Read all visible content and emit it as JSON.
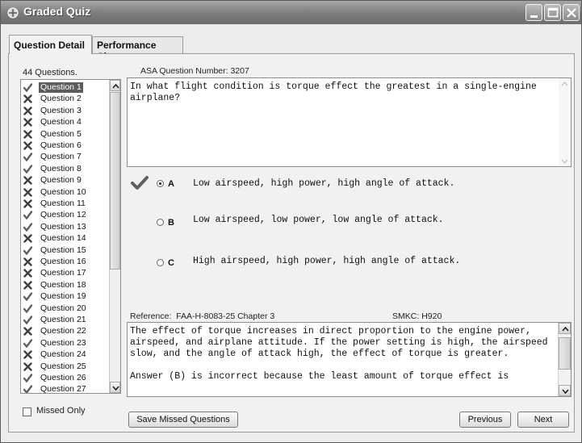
{
  "window": {
    "title": "Graded Quiz"
  },
  "tabs": [
    {
      "label": "Question Detail",
      "active": true
    },
    {
      "label": "Performance Chart",
      "active": false
    }
  ],
  "question_list": {
    "count_label": "44 Questions.",
    "selected": "Question 1",
    "items": [
      {
        "label": "Question 1",
        "result": "correct"
      },
      {
        "label": "Question 2",
        "result": "wrong"
      },
      {
        "label": "Question 3",
        "result": "wrong"
      },
      {
        "label": "Question 4",
        "result": "wrong"
      },
      {
        "label": "Question 5",
        "result": "wrong"
      },
      {
        "label": "Question 6",
        "result": "wrong"
      },
      {
        "label": "Question 7",
        "result": "correct"
      },
      {
        "label": "Question 8",
        "result": "correct"
      },
      {
        "label": "Question 9",
        "result": "wrong"
      },
      {
        "label": "Question 10",
        "result": "wrong"
      },
      {
        "label": "Question 11",
        "result": "wrong"
      },
      {
        "label": "Question 12",
        "result": "correct"
      },
      {
        "label": "Question 13",
        "result": "correct"
      },
      {
        "label": "Question 14",
        "result": "wrong"
      },
      {
        "label": "Question 15",
        "result": "correct"
      },
      {
        "label": "Question 16",
        "result": "wrong"
      },
      {
        "label": "Question 17",
        "result": "wrong"
      },
      {
        "label": "Question 18",
        "result": "wrong"
      },
      {
        "label": "Question 19",
        "result": "correct"
      },
      {
        "label": "Question 20",
        "result": "correct"
      },
      {
        "label": "Question 21",
        "result": "correct"
      },
      {
        "label": "Question 22",
        "result": "wrong"
      },
      {
        "label": "Question 23",
        "result": "correct"
      },
      {
        "label": "Question 24",
        "result": "wrong"
      },
      {
        "label": "Question 25",
        "result": "wrong"
      },
      {
        "label": "Question 26",
        "result": "correct"
      },
      {
        "label": "Question 27",
        "result": "correct"
      }
    ]
  },
  "missed_only": {
    "label": "Missed Only",
    "checked": false
  },
  "question": {
    "number_label": "ASA Question Number: 3207",
    "text": "In what flight condition is torque effect the greatest in a single-engine airplane?"
  },
  "answers": [
    {
      "letter": "A",
      "text": "Low airspeed, high power, high angle of attack.",
      "selected": true,
      "correct_mark": true
    },
    {
      "letter": "B",
      "text": "Low airspeed, low power, low angle of attack.",
      "selected": false,
      "correct_mark": false
    },
    {
      "letter": "C",
      "text": "High airspeed, high power, high angle of attack.",
      "selected": false,
      "correct_mark": false
    }
  ],
  "reference": {
    "label": "Reference:",
    "value": "FAA-H-8083-25 Chapter 3"
  },
  "smkc": {
    "label": "SMKC:",
    "value": "H920"
  },
  "explanation": {
    "paragraphs": [
      "The effect of torque increases in direct proportion to the engine power, airspeed, and airplane attitude. If the power setting is high, the airspeed slow, and the angle of attack high, the effect of torque is greater.",
      "Answer (B) is incorrect because the least amount of torque effect is"
    ]
  },
  "buttons": {
    "save_missed": "Save Missed Questions",
    "previous": "Previous",
    "next": "Next"
  },
  "icons": {
    "correct": "checkmark-icon",
    "wrong": "x-icon"
  },
  "colors": {
    "correct": "#5f5f5f",
    "wrong": "#3f3f3f"
  }
}
